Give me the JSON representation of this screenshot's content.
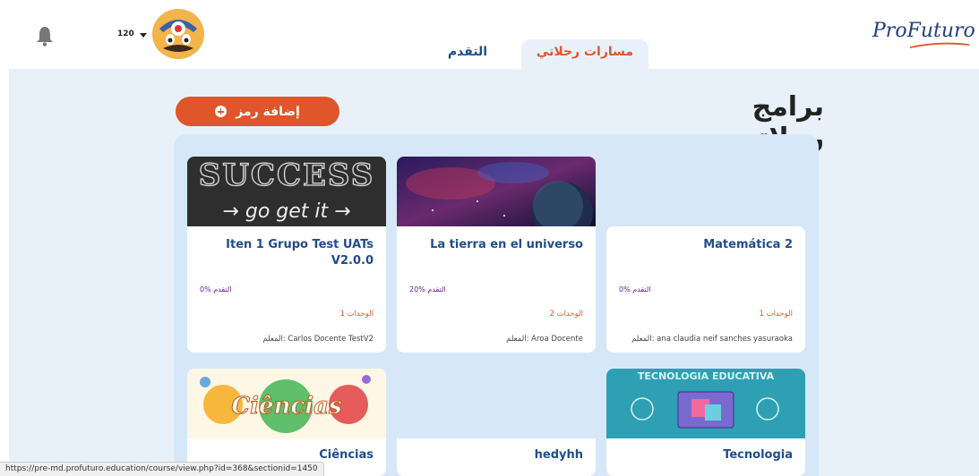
{
  "header": {
    "points": "120",
    "logo": "ProFuturo",
    "tabs": [
      {
        "label": "التقدم",
        "active": false
      },
      {
        "label": "مسارات رحلاتي",
        "active": true
      }
    ]
  },
  "main": {
    "title": "برامج رحلاتي",
    "add_button": "إضافة رمز"
  },
  "courses": [
    {
      "title": "Iten 1 Grupo Test UATs V2.0.0",
      "progress": "0% التقدم",
      "units": "1 الوحدات",
      "teacher": "المعلم: Carlos Docente TestV2",
      "image": "success-chalkboard",
      "image_text": "SUCCESS go get it"
    },
    {
      "title": "La tierra en el universo",
      "progress": "20% التقدم",
      "units": "2 الوحدات",
      "teacher": "المعلم: Aroa Docente",
      "image": "space-planet"
    },
    {
      "title": "Matemática 2",
      "progress": "0% التقدم",
      "units": "1 الوحدات",
      "teacher": "المعلم: ana claudia neif sanches yasuraoka",
      "image": "none"
    },
    {
      "title": "Ciências",
      "image": "ciencias-illustration",
      "image_text": "Ciências"
    },
    {
      "title": "hedyhh",
      "image": "none"
    },
    {
      "title": "Tecnologia",
      "image": "tecnologia-educativa",
      "image_text": "TECNOLOGIA EDUCATIVA"
    }
  ],
  "statusbar": {
    "url": "https://pre-md.profuturo.education/course/view.php?id=368&sectionid=1450"
  },
  "colors": {
    "accent": "#e0552a",
    "navy": "#1f4d8a",
    "bg": "#e8f1fa",
    "panel": "#d6e8f8"
  }
}
